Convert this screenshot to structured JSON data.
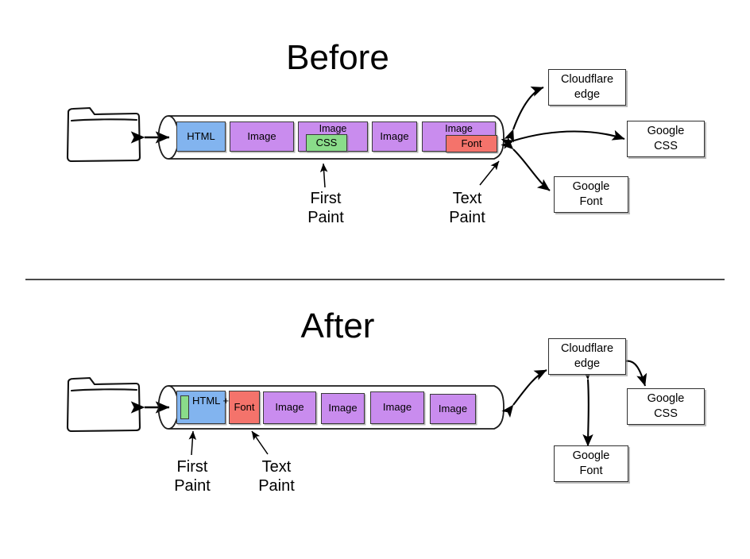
{
  "sections": {
    "before": {
      "title": "Before",
      "pipeline_blocks": [
        {
          "label": "HTML",
          "kind": "html"
        },
        {
          "label": "Image",
          "kind": "image"
        },
        {
          "label": "Image",
          "kind": "image",
          "nested": {
            "label": "CSS",
            "kind": "css"
          }
        },
        {
          "label": "Image",
          "kind": "image"
        },
        {
          "label": "Image",
          "kind": "image",
          "nested": {
            "label": "Font",
            "kind": "font"
          }
        }
      ],
      "annotations": [
        {
          "label": "First\nPaint"
        },
        {
          "label": "Text\nPaint"
        }
      ],
      "resource_boxes": [
        {
          "label": "Cloudflare\nedge"
        },
        {
          "label": "Google\nCSS"
        },
        {
          "label": "Google\nFont"
        }
      ]
    },
    "after": {
      "title": "After",
      "pipeline_blocks": [
        {
          "label": "HTML\n+ CSS",
          "kind": "htmlcss",
          "has_css_sliver": true
        },
        {
          "label": "Font",
          "kind": "font"
        },
        {
          "label": "Image",
          "kind": "image"
        },
        {
          "label": "Image",
          "kind": "image"
        },
        {
          "label": "Image",
          "kind": "image"
        },
        {
          "label": "Image",
          "kind": "image"
        }
      ],
      "annotations": [
        {
          "label": "First\nPaint"
        },
        {
          "label": "Text\nPaint"
        }
      ],
      "resource_boxes": [
        {
          "label": "Cloudflare\nedge"
        },
        {
          "label": "Google\nCSS"
        },
        {
          "label": "Google\nFont"
        }
      ]
    }
  },
  "colors": {
    "html": "#82b4ef",
    "image": "#c98cee",
    "css": "#8adc8a",
    "font": "#f4736b",
    "stroke": "#2f2f2f",
    "background": "#ffffff"
  }
}
